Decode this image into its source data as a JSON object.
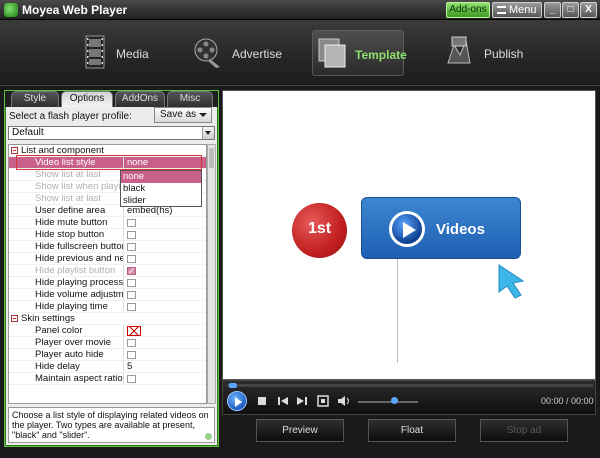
{
  "app": {
    "title": "Moyea Web Player"
  },
  "titlebar": {
    "addons_label": "Add-ons",
    "menu_label": "Menu",
    "minimize": "_",
    "maximize": "□",
    "close": "X"
  },
  "toolbar": {
    "items": [
      {
        "label": "Media",
        "icon": "film-icon"
      },
      {
        "label": "Advertise",
        "icon": "film-reel-icon"
      },
      {
        "label": "Template",
        "icon": "template-icon",
        "active": true
      },
      {
        "label": "Publish",
        "icon": "publish-icon"
      }
    ]
  },
  "tabs": [
    "Style",
    "Options",
    "AddOns",
    "Misc"
  ],
  "profile": {
    "label": "Select a flash player profile:",
    "save_as": "Save as",
    "value": "Default"
  },
  "grid": {
    "rows": [
      {
        "name": "List and component",
        "type": "category"
      },
      {
        "name": "Video list style",
        "value": "none",
        "type": "select",
        "highlight": true
      },
      {
        "name": "Show list at last",
        "disabled": true
      },
      {
        "name": "Show list when playing",
        "disabled": true
      },
      {
        "name": "Show list at last",
        "disabled": true
      },
      {
        "name": "User define area",
        "value": "embed(hs)"
      },
      {
        "name": "Hide mute button",
        "type": "checkbox",
        "checked": false
      },
      {
        "name": "Hide stop button",
        "type": "checkbox",
        "checked": false
      },
      {
        "name": "Hide fullscreen button",
        "type": "checkbox",
        "checked": false
      },
      {
        "name": "Hide previous and ne...",
        "type": "checkbox",
        "checked": false
      },
      {
        "name": "Hide playlist button",
        "type": "checkbox",
        "checked": true,
        "disabled": true
      },
      {
        "name": "Hide playing process ...",
        "type": "checkbox",
        "checked": false
      },
      {
        "name": "Hide volume adjustme...",
        "type": "checkbox",
        "checked": false
      },
      {
        "name": "Hide playing time",
        "type": "checkbox",
        "checked": false
      },
      {
        "name": "Skin settings",
        "type": "category"
      },
      {
        "name": "Panel color",
        "type": "color"
      },
      {
        "name": "Player over movie",
        "type": "checkbox",
        "checked": false
      },
      {
        "name": "Player auto hide",
        "type": "checkbox",
        "checked": false
      },
      {
        "name": "Hide delay",
        "value": "5"
      },
      {
        "name": "Maintain aspect ratio",
        "type": "checkbox",
        "checked": false
      }
    ]
  },
  "dropdown": {
    "options": [
      "none",
      "black",
      "slider"
    ],
    "selected": "none"
  },
  "description": "Choose a list style of displaying related videos on the player. Two types are available at present, \"black\" and \"slider\".",
  "preview": {
    "badge": "1st",
    "button_label": "Videos"
  },
  "player": {
    "time": "00:00 / 00:00"
  },
  "bottom": {
    "preview": "Preview",
    "float": "Float",
    "stop_ad": "Stop ad"
  },
  "colors": {
    "accent": "#5fbf3e",
    "highlight": "#c8608a",
    "play_blue": "#1f5fb3",
    "badge_red": "#c21f1f"
  }
}
